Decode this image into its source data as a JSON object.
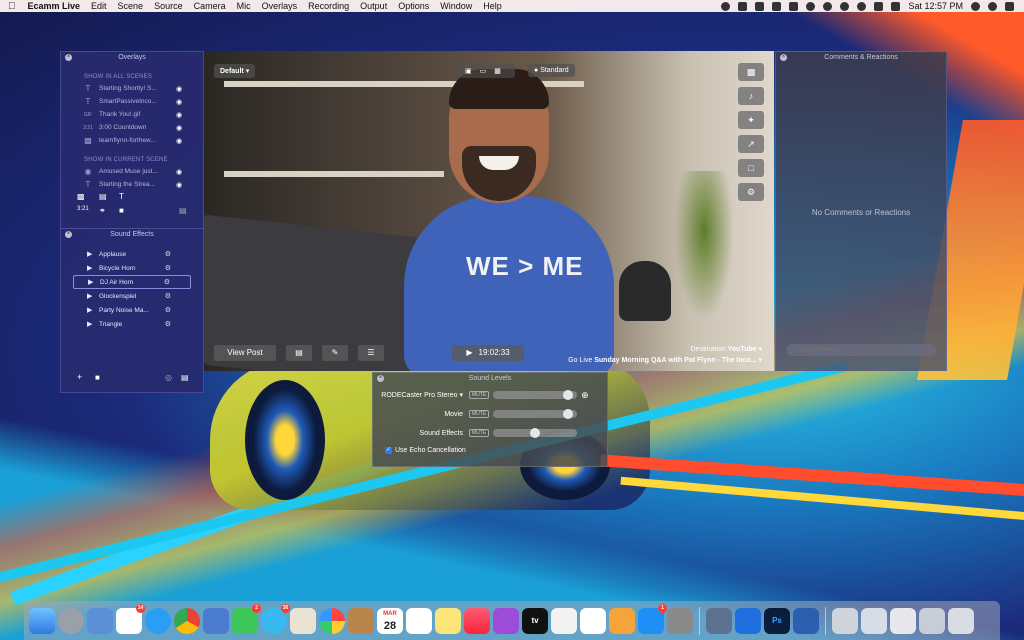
{
  "menubar": {
    "apple": "",
    "items": [
      "Ecamm Live",
      "Edit",
      "Scene",
      "Source",
      "Camera",
      "Mic",
      "Overlays",
      "Recording",
      "Output",
      "Options",
      "Window",
      "Help"
    ],
    "clock": "Sat 12:57 PM"
  },
  "overlays": {
    "title": "Overlays",
    "section_all": "SHOW IN ALL SCENES",
    "all_items": [
      {
        "icon": "T",
        "label": "Starting Shortly! S..."
      },
      {
        "icon": "T",
        "label": "SmartPassiveInco..."
      },
      {
        "icon": "GIF",
        "label": "Thank You!.gif"
      },
      {
        "icon": "3:21",
        "label": "3:00 Countdown"
      },
      {
        "icon": "img",
        "label": "teamflynn-forthew..."
      }
    ],
    "section_current": "SHOW IN CURRENT SCENE",
    "current_items": [
      {
        "icon": "img",
        "label": "Amused Muse just..."
      },
      {
        "icon": "T",
        "label": "Starting the Strea..."
      }
    ],
    "countdown_tool": "3:21"
  },
  "sound_effects": {
    "title": "Sound Effects",
    "items": [
      "Applause",
      "Bicycle Horn",
      "DJ Air Horn",
      "Glockenspiel",
      "Party Noise Ma...",
      "Triangle"
    ],
    "selected_index": 2
  },
  "video": {
    "scene": "Default",
    "layout": "Standard",
    "view_post": "View Post",
    "timer": "19:02:33",
    "destination_label": "Destination",
    "destination": "YouTube",
    "go_live_label": "Go Live",
    "go_live_title": "Sunday Morning Q&A with Pat Flynn - The Inco...",
    "shirt_text": "WE > ME"
  },
  "comments": {
    "title": "Comments & Reactions",
    "empty": "No Comments or Reactions",
    "placeholder": "Add a comment..."
  },
  "sound_levels": {
    "title": "Sound Levels",
    "rows": [
      {
        "name": "RODECaster Pro Stereo",
        "mute": "MUTE",
        "level": 0.95
      },
      {
        "name": "Movie",
        "mute": "MUTE",
        "level": 0.95
      },
      {
        "name": "Sound Effects",
        "mute": "MUTE",
        "level": 0.5
      }
    ],
    "echo": "Use Echo Cancellation",
    "echo_checked": true
  },
  "dock": {
    "calendar_month": "MAR",
    "calendar_day": "28",
    "photoshop": "Ps",
    "appletv": "tv",
    "badges": {
      "slack": "14",
      "facetime": "2",
      "messages": "36",
      "appstore": "1"
    }
  }
}
